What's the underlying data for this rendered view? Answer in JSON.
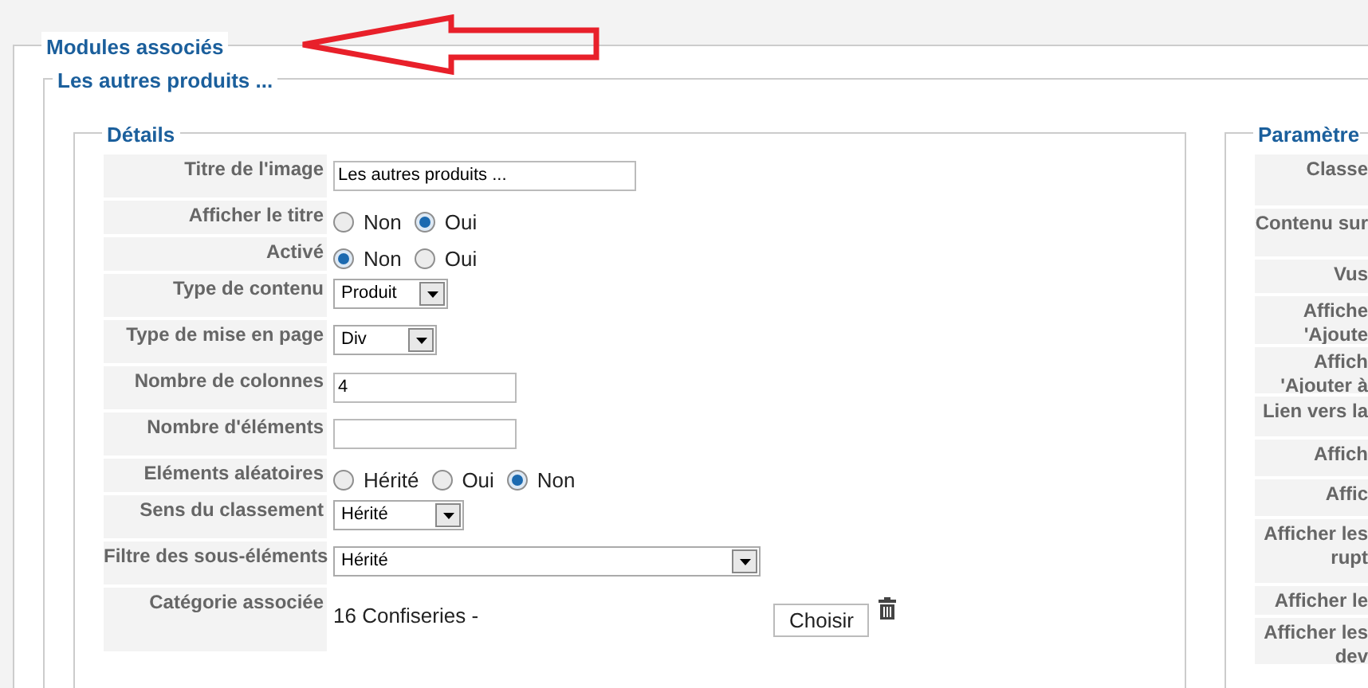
{
  "outer_legend": "Modules associés",
  "module_legend": "Les autres produits ...",
  "details": {
    "legend": "Détails",
    "rows": [
      {
        "label": "Titre de l'image",
        "kind": "text",
        "value": "Les autres produits ..."
      },
      {
        "label": "Afficher le titre",
        "kind": "radio",
        "options": [
          {
            "label": "Non",
            "selected": false
          },
          {
            "label": "Oui",
            "selected": true
          }
        ]
      },
      {
        "label": "Activé",
        "kind": "radio",
        "options": [
          {
            "label": "Non",
            "selected": true
          },
          {
            "label": "Oui",
            "selected": false
          }
        ]
      },
      {
        "label": "Type de contenu",
        "kind": "select",
        "value": "Produit"
      },
      {
        "label": "Type de mise en page",
        "kind": "select",
        "value": "Div"
      },
      {
        "label": "Nombre de colonnes",
        "kind": "text",
        "value": "4"
      },
      {
        "label": "Nombre d'éléments",
        "kind": "text"
      },
      {
        "label": "Eléments aléatoires",
        "kind": "radio",
        "options": [
          {
            "label": "Hérité",
            "selected": false
          },
          {
            "label": "Oui",
            "selected": false
          },
          {
            "label": "Non",
            "selected": true
          }
        ]
      },
      {
        "label": "Sens du classement",
        "kind": "select",
        "value": "Hérité"
      },
      {
        "label": "Filtre des sous-éléments",
        "kind": "select",
        "value": "Hérité"
      },
      {
        "label": "Catégorie associée",
        "kind": "category",
        "value": "16 Confiseries -",
        "button": "Choisir"
      }
    ]
  },
  "parameters": {
    "legend": "Paramètre",
    "rows": [
      {
        "label": "Classe"
      },
      {
        "label": "Contenu sur"
      },
      {
        "label": "Vus"
      },
      {
        "label": "Affiche\n'Ajoute"
      },
      {
        "label": "Affich\n'Ajouter à"
      },
      {
        "label": "Lien vers la"
      },
      {
        "label": "Affich"
      },
      {
        "label": "Affic"
      },
      {
        "label": "Afficher les\nrupt"
      },
      {
        "label": "Afficher le"
      },
      {
        "label": "Afficher les\ndev"
      }
    ]
  }
}
